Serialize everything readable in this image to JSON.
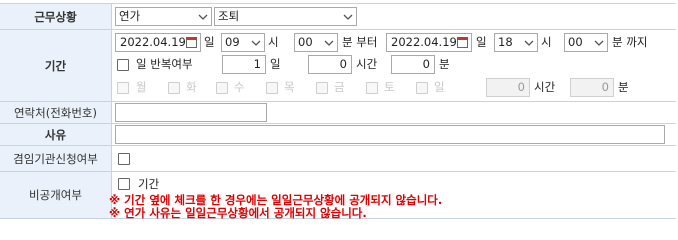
{
  "rows": {
    "status": {
      "label": "근무상황",
      "category": "연가",
      "type": "조퇴"
    },
    "period": {
      "label": "기간",
      "start_date": "2022.04.19",
      "unit_day": "일",
      "start_hour": "09",
      "unit_hour": "시",
      "start_min": "00",
      "unit_min_from": "분 부터",
      "end_date": "2022.04.19",
      "end_hour": "18",
      "end_min": "00",
      "unit_min_to": "분 까지",
      "repeat_label": "일 반복여부",
      "repeat_days": "1",
      "unit_days": "일",
      "hours": "0",
      "unit_hours": "시간",
      "minutes": "0",
      "unit_minutes": "분",
      "weekdays": [
        "월",
        "화",
        "수",
        "목",
        "금",
        "토",
        "일"
      ],
      "weekday_hours": "0",
      "weekday_unit_hours": "시간",
      "weekday_minutes": "0",
      "weekday_unit_minutes": "분"
    },
    "contact": {
      "label": "연락처(전화번호)",
      "value": ""
    },
    "reason": {
      "label": "사유",
      "value": ""
    },
    "concurrent": {
      "label": "겸임기관신청여부"
    },
    "private": {
      "label": "비공개여부",
      "option_label": "기간",
      "notice_1": "※ 기간 옆에 체크를 한 경우에는 일일근무상황에 공개되지 않습니다.",
      "notice_2": "※ 연가 사유는 일일근무상황에서 공개되지 않습니다."
    }
  }
}
